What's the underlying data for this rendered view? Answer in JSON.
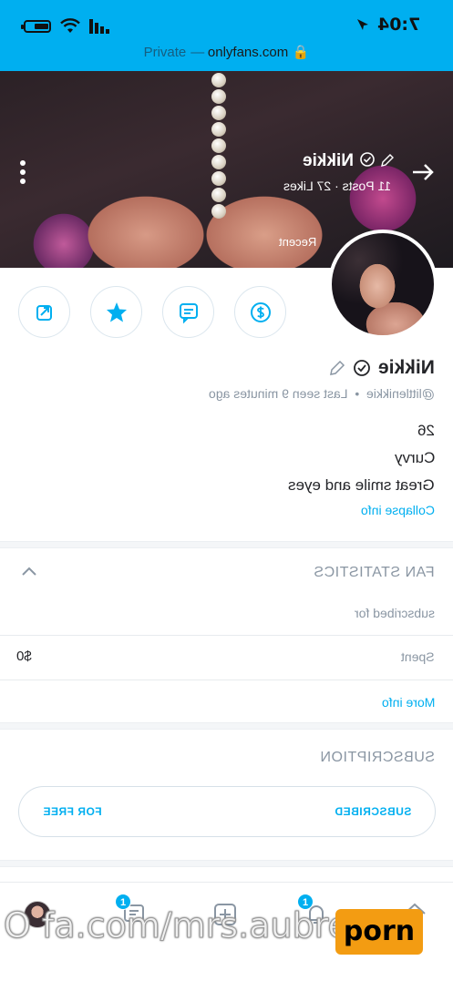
{
  "status_bar": {
    "time": "7:04"
  },
  "browser": {
    "url": "onlyfans.com",
    "mode": "Private",
    "separator": "—"
  },
  "cover": {
    "name": "Nikkie",
    "stats": "11 Posts · 27 Likes",
    "recent_label": "Recent"
  },
  "actions": [
    {
      "icon": "dollar-icon"
    },
    {
      "icon": "message-icon"
    },
    {
      "icon": "star-icon"
    },
    {
      "icon": "share-icon"
    }
  ],
  "profile": {
    "name": "Nikkie",
    "handle": "@littlenikkie",
    "last_seen": "Last seen 9 minutes ago",
    "bio": [
      "26",
      "Curvy",
      "Great smile and eyes"
    ],
    "collapse_label": "Collapse info"
  },
  "fan_statistics": {
    "title": "FAN STATISTICS",
    "subscribed_for_label": "subscribed for",
    "spent_label": "Spent",
    "spent_value": "$0",
    "more_info_label": "More info"
  },
  "subscription": {
    "title": "SUBSCRIPTION",
    "status_label": "SUBSCRIBED",
    "price_label": "FOR FREE"
  },
  "bottom_nav": {
    "items": [
      {
        "icon": "home-icon"
      },
      {
        "icon": "notifications-icon",
        "badge": "1"
      },
      {
        "icon": "add-post-icon"
      },
      {
        "icon": "messages-icon",
        "badge": "1"
      },
      {
        "icon": "profile-avatar"
      }
    ]
  },
  "watermark": {
    "text": "O  fa.com/mrs.aubree2",
    "logo": "porn",
    "logo_color": "#f39c12"
  },
  "colors": {
    "accent": "#00aff0",
    "muted": "#8a96a3",
    "text": "#242529"
  }
}
